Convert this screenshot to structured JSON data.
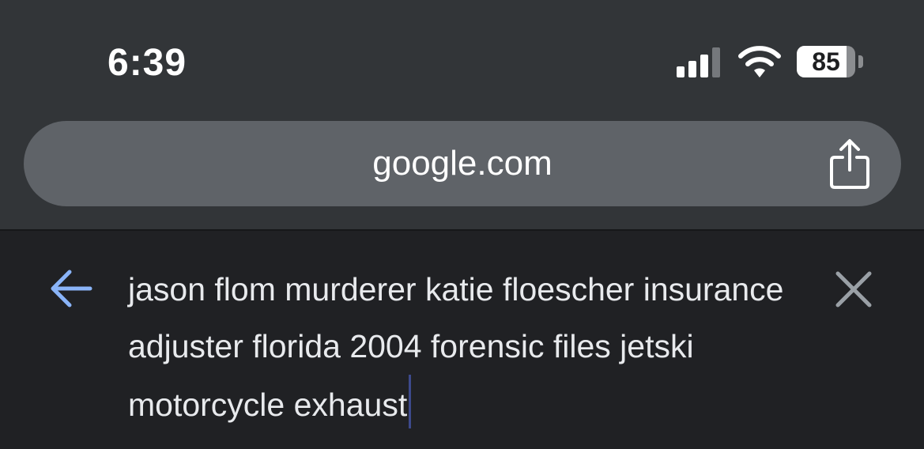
{
  "status_bar": {
    "time": "6:39",
    "signal_icon": "cellular-signal-icon",
    "wifi_icon": "wifi-icon",
    "battery_level": "85",
    "battery_fraction": 0.85
  },
  "address_bar": {
    "url": "google.com",
    "share_icon": "share-icon"
  },
  "search": {
    "back_icon": "back-arrow-icon",
    "query": "jason flom murderer katie floescher insurance adjuster florida 2004 forensic files jetski motorcycle exhaust",
    "clear_icon": "close-icon"
  },
  "colors": {
    "top_background": "#323538",
    "url_bar": "#5f6368",
    "page_background": "#202124",
    "back_arrow": "#8ab4f8",
    "close": "#9aa0a6"
  }
}
